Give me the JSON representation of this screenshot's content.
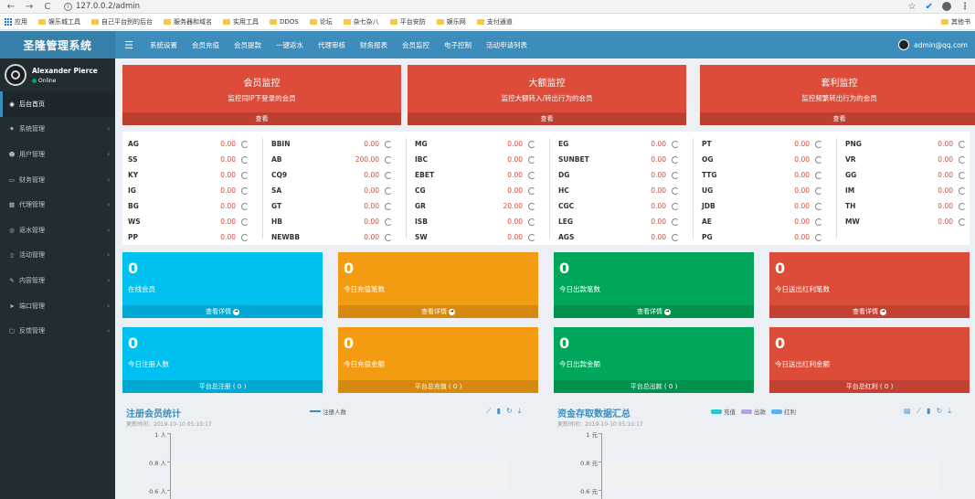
{
  "browser": {
    "url": "127.0.0.2/admin"
  },
  "bookmarks": {
    "items": [
      "应用",
      "娱乐城工具",
      "自己平台别的后台",
      "服务器和域名",
      "实用工具",
      "DDOS",
      "论坛",
      "杂七杂八",
      "平台安防",
      "娱乐网",
      "支付通道"
    ],
    "right": "其他书"
  },
  "header": {
    "logo": "圣隆管理系统",
    "nav": [
      "系统设置",
      "会员充值",
      "会员提款",
      "一键返水",
      "代理审核",
      "财务报表",
      "会员监控",
      "电子控制",
      "活动申请列表"
    ],
    "user_email": "admin@qq.com"
  },
  "sidebar": {
    "user_name": "Alexander Pierce",
    "status": "Online",
    "items": [
      {
        "label": "后台首页",
        "icon": "dashboard-icon",
        "glyph": "◉",
        "active": true,
        "chevron": false
      },
      {
        "label": "系统管理",
        "icon": "gear-icon",
        "glyph": "✷",
        "active": false,
        "chevron": true
      },
      {
        "label": "用户管理",
        "icon": "users-icon",
        "glyph": "☻",
        "active": false,
        "chevron": true
      },
      {
        "label": "财务管理",
        "icon": "money-icon",
        "glyph": "▭",
        "active": false,
        "chevron": true
      },
      {
        "label": "代理管理",
        "icon": "table-icon",
        "glyph": "▦",
        "active": false,
        "chevron": true
      },
      {
        "label": "返水管理",
        "icon": "eye-icon",
        "glyph": "◎",
        "active": false,
        "chevron": true
      },
      {
        "label": "活动管理",
        "icon": "book-icon",
        "glyph": "▯",
        "active": false,
        "chevron": true
      },
      {
        "label": "内容管理",
        "icon": "wrench-icon",
        "glyph": "✎",
        "active": false,
        "chevron": true
      },
      {
        "label": "端口管理",
        "icon": "send-icon",
        "glyph": "➤",
        "active": false,
        "chevron": true
      },
      {
        "label": "反馈管理",
        "icon": "comment-icon",
        "glyph": "▢",
        "active": false,
        "chevron": true
      }
    ]
  },
  "monitors": [
    {
      "title": "会员监控",
      "desc": "监控同IP下登录的会员",
      "link": "查看"
    },
    {
      "title": "大额监控",
      "desc": "监控大额转入/转出行为的会员",
      "link": "查看"
    },
    {
      "title": "套利监控",
      "desc": "监控频繁转出行为的会员",
      "link": "查看"
    }
  ],
  "platforms": [
    [
      {
        "name": "AG",
        "value": "0.00"
      },
      {
        "name": "SS",
        "value": "0.00"
      },
      {
        "name": "KY",
        "value": "0.00"
      },
      {
        "name": "IG",
        "value": "0.00"
      },
      {
        "name": "BG",
        "value": "0.00"
      },
      {
        "name": "WS",
        "value": "0.00"
      },
      {
        "name": "PP",
        "value": "0.00"
      }
    ],
    [
      {
        "name": "BBIN",
        "value": "0.00"
      },
      {
        "name": "AB",
        "value": "200.00"
      },
      {
        "name": "CQ9",
        "value": "0.00"
      },
      {
        "name": "SA",
        "value": "0.00"
      },
      {
        "name": "GT",
        "value": "0.00"
      },
      {
        "name": "HB",
        "value": "0.00"
      },
      {
        "name": "NEWBB",
        "value": "0.00"
      }
    ],
    [
      {
        "name": "MG",
        "value": "0.00"
      },
      {
        "name": "IBC",
        "value": "0.00"
      },
      {
        "name": "EBET",
        "value": "0.00"
      },
      {
        "name": "CG",
        "value": "0.00"
      },
      {
        "name": "GR",
        "value": "20.00"
      },
      {
        "name": "ISB",
        "value": "0.00"
      },
      {
        "name": "SW",
        "value": "0.00"
      }
    ],
    [
      {
        "name": "EG",
        "value": "0.00"
      },
      {
        "name": "SUNBET",
        "value": "0.00"
      },
      {
        "name": "DG",
        "value": "0.00"
      },
      {
        "name": "HC",
        "value": "0.00"
      },
      {
        "name": "CGC",
        "value": "0.00"
      },
      {
        "name": "LEG",
        "value": "0.00"
      },
      {
        "name": "AGS",
        "value": "0.00"
      }
    ],
    [
      {
        "name": "PT",
        "value": "0.00"
      },
      {
        "name": "OG",
        "value": "0.00"
      },
      {
        "name": "TTG",
        "value": "0.00"
      },
      {
        "name": "UG",
        "value": "0.00"
      },
      {
        "name": "JDB",
        "value": "0.00"
      },
      {
        "name": "AE",
        "value": "0.00"
      },
      {
        "name": "PG",
        "value": "0.00"
      }
    ],
    [
      {
        "name": "PNG",
        "value": "0.00"
      },
      {
        "name": "VR",
        "value": "0.00"
      },
      {
        "name": "GG",
        "value": "0.00"
      },
      {
        "name": "IM",
        "value": "0.00"
      },
      {
        "name": "TH",
        "value": "0.00"
      },
      {
        "name": "MW",
        "value": "0.00"
      }
    ]
  ],
  "stats_row1": [
    {
      "number": "0",
      "label": "在线会员",
      "footer": "查看详情",
      "color": "aqua"
    },
    {
      "number": "0",
      "label": "今日充值笔数",
      "footer": "查看详情",
      "color": "orange"
    },
    {
      "number": "0",
      "label": "今日出款笔数",
      "footer": "查看详情",
      "color": "green"
    },
    {
      "number": "0",
      "label": "今日送出红利笔数",
      "footer": "查看详情",
      "color": "red"
    }
  ],
  "stats_row2": [
    {
      "number": "0",
      "label": "今日注册人数",
      "footer": "平台总注册 ( 0 )",
      "color": "aqua"
    },
    {
      "number": "0",
      "label": "今日充值金额",
      "footer": "平台总充值 ( 0 )",
      "color": "orange"
    },
    {
      "number": "0",
      "label": "今日出款金额",
      "footer": "平台总出款 ( 0 )",
      "color": "green"
    },
    {
      "number": "0",
      "label": "今日送出红利金额",
      "footer": "平台总红利 ( 0 )",
      "color": "red"
    }
  ],
  "charts": [
    {
      "title": "注册会员统计",
      "subtitle": "更新时间：2019-10-10 05:10:17",
      "legend": [
        {
          "name": "注册人数",
          "color": "#3c8dbc"
        }
      ],
      "y_ticks": [
        "1 人",
        "0.8 人",
        "0.6 人"
      ],
      "toolbox": [
        "line-chart-icon",
        "bar-chart-icon",
        "refresh-icon",
        "download-icon"
      ]
    },
    {
      "title": "资金存取数据汇总",
      "subtitle": "更新时间：2019-10-10 05:10:17",
      "legend": [
        {
          "name": "充值",
          "color": "#2ec7c9"
        },
        {
          "name": "出款",
          "color": "#b6a2de"
        },
        {
          "name": "红利",
          "color": "#5ab1ef"
        }
      ],
      "y_ticks": [
        "1 元",
        "0.8 元",
        "0.6 元"
      ],
      "toolbox": [
        "data-view-icon",
        "line-chart-icon",
        "bar-chart-icon",
        "refresh-icon",
        "download-icon"
      ]
    }
  ]
}
